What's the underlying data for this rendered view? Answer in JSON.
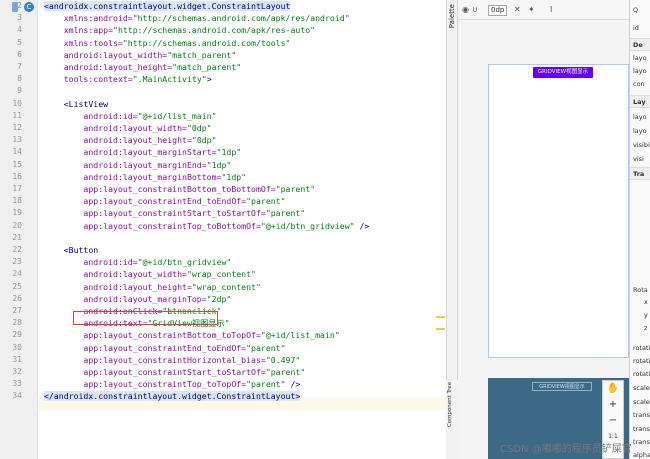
{
  "editor": {
    "line_numbers": [
      "2",
      "3",
      "4",
      "5",
      "6",
      "7",
      "8",
      "9",
      "10",
      "11",
      "12",
      "13",
      "14",
      "15",
      "16",
      "17",
      "18",
      "19",
      "20",
      "21",
      "22",
      "23",
      "24",
      "25",
      "26",
      "27",
      "28",
      "29",
      "30",
      "31",
      "32",
      "33",
      "34"
    ],
    "lines": [
      [
        {
          "t": "<androidx.constraintlayout.widget.ConstraintLayout",
          "c": "tag sel"
        }
      ],
      [
        {
          "t": "    xmlns:android=",
          "c": "attr"
        },
        {
          "t": "\"http://schemas.android.com/apk/res/android\"",
          "c": "val"
        }
      ],
      [
        {
          "t": "    xmlns:app=",
          "c": "attr"
        },
        {
          "t": "\"http://schemas.android.com/apk/res-auto\"",
          "c": "val"
        }
      ],
      [
        {
          "t": "    xmlns:tools=",
          "c": "attr"
        },
        {
          "t": "\"http://schemas.android.com/tools\"",
          "c": "val"
        }
      ],
      [
        {
          "t": "    android:layout_width=",
          "c": "attr"
        },
        {
          "t": "\"match_parent\"",
          "c": "val"
        }
      ],
      [
        {
          "t": "    android:layout_height=",
          "c": "attr"
        },
        {
          "t": "\"match_parent\"",
          "c": "val"
        }
      ],
      [
        {
          "t": "    tools:context=",
          "c": "attr"
        },
        {
          "t": "\".MainActivity\"",
          "c": "val"
        },
        {
          "t": ">",
          "c": "tag"
        }
      ],
      [],
      [
        {
          "t": "    <ListView",
          "c": "tag"
        }
      ],
      [
        {
          "t": "        android:id=",
          "c": "attr"
        },
        {
          "t": "\"@+id/list_main\"",
          "c": "val"
        }
      ],
      [
        {
          "t": "        android:layout_width=",
          "c": "attr"
        },
        {
          "t": "\"0dp\"",
          "c": "val"
        }
      ],
      [
        {
          "t": "        android:layout_height=",
          "c": "attr"
        },
        {
          "t": "\"0dp\"",
          "c": "val"
        }
      ],
      [
        {
          "t": "        android:layout_marginStart=",
          "c": "attr"
        },
        {
          "t": "\"1dp\"",
          "c": "val"
        }
      ],
      [
        {
          "t": "        android:layout_marginEnd=",
          "c": "attr"
        },
        {
          "t": "\"1dp\"",
          "c": "val"
        }
      ],
      [
        {
          "t": "        android:layout_marginBottom=",
          "c": "attr"
        },
        {
          "t": "\"1dp\"",
          "c": "val"
        }
      ],
      [
        {
          "t": "        app:layout_constraintBottom_toBottomOf=",
          "c": "attr"
        },
        {
          "t": "\"parent\"",
          "c": "val"
        }
      ],
      [
        {
          "t": "        app:layout_constraintEnd_toEndOf=",
          "c": "attr"
        },
        {
          "t": "\"parent\"",
          "c": "val"
        }
      ],
      [
        {
          "t": "        app:layout_constraintStart_toStartOf=",
          "c": "attr"
        },
        {
          "t": "\"parent\"",
          "c": "val"
        }
      ],
      [
        {
          "t": "        app:layout_constraintTop_toBottomOf=",
          "c": "attr"
        },
        {
          "t": "\"@+id/btn_gridview\"",
          "c": "val"
        },
        {
          "t": " />",
          "c": "tag"
        }
      ],
      [],
      [
        {
          "t": "    <Button",
          "c": "tag"
        }
      ],
      [
        {
          "t": "        android:id=",
          "c": "attr"
        },
        {
          "t": "\"@+id/btn_gridview\"",
          "c": "val"
        }
      ],
      [
        {
          "t": "        android:layout_width=",
          "c": "attr"
        },
        {
          "t": "\"wrap_content\"",
          "c": "val"
        }
      ],
      [
        {
          "t": "        android:layout_height=",
          "c": "attr"
        },
        {
          "t": "\"wrap_content\"",
          "c": "val"
        }
      ],
      [
        {
          "t": "        android:layout_marginTop=",
          "c": "attr"
        },
        {
          "t": "\"2dp\"",
          "c": "val"
        }
      ],
      [
        {
          "t": "        android:onClick=",
          "c": "attr"
        },
        {
          "t": "\"btnonclick\"",
          "c": "val"
        }
      ],
      [
        {
          "t": "        android:text=",
          "c": "attr"
        },
        {
          "t": "\"GridView视图显示\"",
          "c": "val"
        }
      ],
      [
        {
          "t": "        app:layout_constraintBottom_toTopOf=",
          "c": "attr"
        },
        {
          "t": "\"@+id/list_main\"",
          "c": "val"
        }
      ],
      [
        {
          "t": "        app:layout_constraintEnd_toEndOf=",
          "c": "attr"
        },
        {
          "t": "\"parent\"",
          "c": "val"
        }
      ],
      [
        {
          "t": "        app:layout_constraintHorizontal_bias=",
          "c": "attr"
        },
        {
          "t": "\"0.497\"",
          "c": "val"
        }
      ],
      [
        {
          "t": "        app:layout_constraintStart_toStartOf=",
          "c": "attr"
        },
        {
          "t": "\"parent\"",
          "c": "val"
        }
      ],
      [
        {
          "t": "        app:layout_constraintTop_toTopOf=",
          "c": "attr"
        },
        {
          "t": "\"parent\"",
          "c": "val"
        },
        {
          "t": " />",
          "c": "tag"
        }
      ],
      [
        {
          "t": "</androidx.constraintlayout.widget.ConstraintLayout>",
          "c": "tag sel"
        }
      ]
    ]
  },
  "side_labels": {
    "palette": "Palette",
    "component_tree": "Component Tree"
  },
  "design": {
    "toolbar_dp": "0dp",
    "button_text": "GRIDVIEW视图显示",
    "blueprint_button_text": "GRIDVIEW视图显示",
    "zoom": {
      "plus": "+",
      "minus": "−",
      "ratio": "1:1",
      "hand": "✋"
    }
  },
  "attributes": {
    "search_icon_label": "Q",
    "id_label": "id",
    "groups": [
      "De",
      "Lay",
      "Tra"
    ],
    "items_a": [
      "layo",
      "layo",
      "con"
    ],
    "items_b": [
      "layo",
      "layo",
      "visibi",
      "visi"
    ],
    "items_c": [
      "Rota",
      "x",
      "y",
      "z",
      "rotati",
      "rotati",
      "rotati",
      "scaleX",
      "scaleY",
      "transl",
      "transl",
      "transl",
      "alpha"
    ]
  },
  "watermark": "CSDN @嘟嘟的程序员铲屎官",
  "colors": {
    "tag": "#000080",
    "attr": "#871094",
    "val": "#067d17",
    "button": "#6200ee",
    "blueprint": "#3c6a86",
    "highlight": "#e23c3c"
  }
}
